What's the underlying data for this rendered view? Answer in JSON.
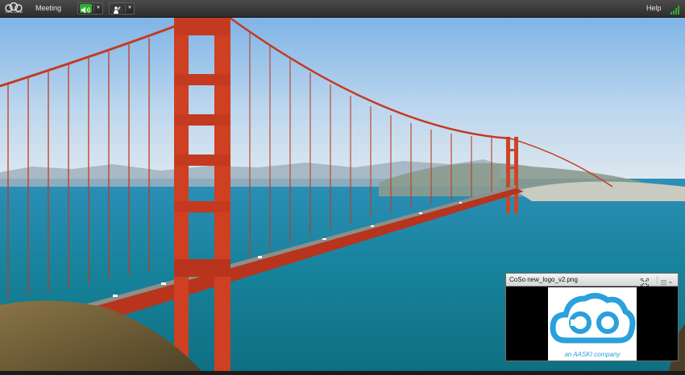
{
  "toolbar": {
    "logo_text": "CoSo Cloud",
    "meeting_label": "Meeting",
    "help_label": "Help",
    "speaker_icon": "speaker-icon",
    "attendee_icon": "raise-hand-icon",
    "signal_icon": "connection-signal-icon"
  },
  "pod": {
    "title": "CoSo new_logo_v2.png",
    "image_logo_text": "coso",
    "image_caption": "an AASKI company"
  },
  "colors": {
    "accent_green": "#2fae2f",
    "logo_blue": "#2aa0dc",
    "bridge_red": "#c43a20"
  }
}
